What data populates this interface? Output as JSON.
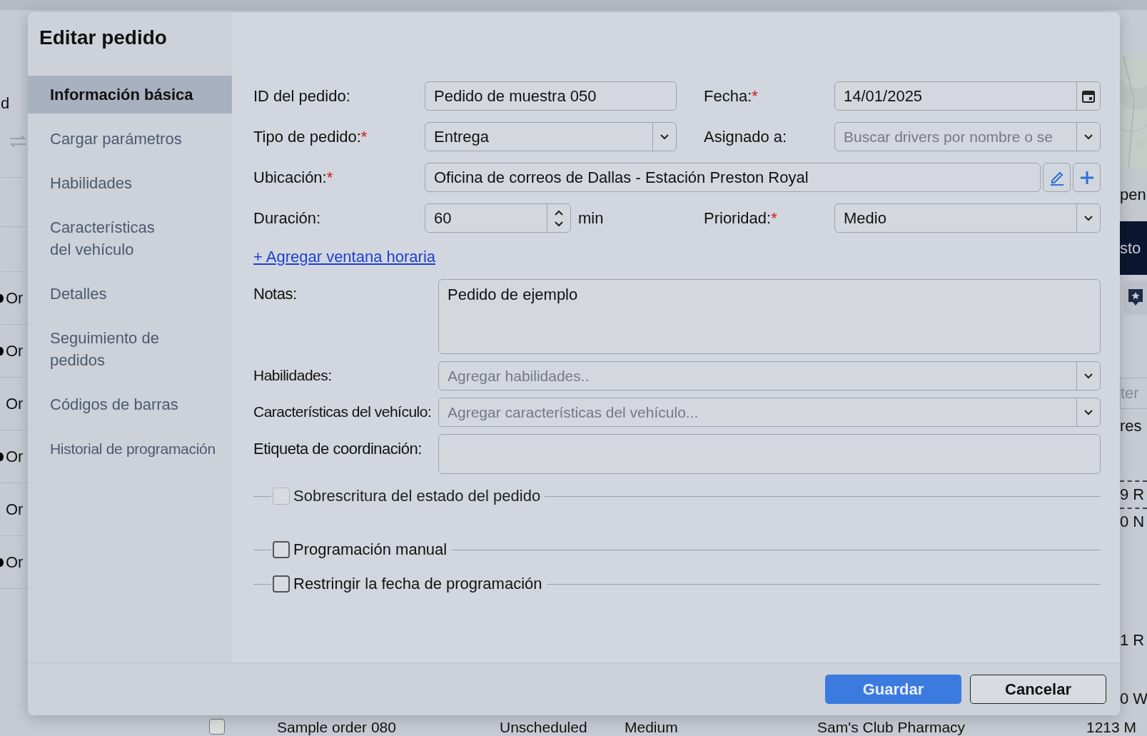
{
  "background": {
    "left_column": {
      "header_fragment": "d",
      "rows": [
        {
          "text": "Or",
          "dot": true
        },
        {
          "text": "Or",
          "dot": true
        },
        {
          "text": "Or",
          "dot": false
        },
        {
          "text": "Or",
          "dot": true
        },
        {
          "text": "Or",
          "dot": false
        },
        {
          "text": "Or",
          "dot": true
        }
      ]
    },
    "right_column": {
      "map_button": "pen",
      "banner": "sto",
      "filter_fragment": "ter",
      "rows": [
        {
          "text": "res",
          "dashed": false
        },
        {
          "text": "9 R",
          "dashed": true
        },
        {
          "text": "0 N",
          "dashed": true
        },
        {
          "text": "1 R",
          "dashed": false
        },
        {
          "text": "0 W",
          "dashed": false
        }
      ]
    },
    "bottom_row": {
      "checked": false,
      "cells": [
        "Sample order 080",
        "Unscheduled",
        "Medium",
        "Sam's Club Pharmacy",
        "1213 M"
      ]
    }
  },
  "dialog": {
    "title": "Editar pedido",
    "nav": [
      {
        "label": "Información básica",
        "selected": true
      },
      {
        "label": "Cargar parámetros",
        "selected": false
      },
      {
        "label": "Habilidades",
        "selected": false
      },
      {
        "label": "Características del vehículo",
        "selected": false
      },
      {
        "label": "Detalles",
        "selected": false
      },
      {
        "label": "Seguimiento de pedidos",
        "selected": false
      },
      {
        "label": "Códigos de barras",
        "selected": false
      },
      {
        "label": "Historial de programación",
        "selected": false
      }
    ],
    "form_rows": [
      [
        {
          "label": "ID del pedido:",
          "kind": "text",
          "value": "Pedido de muestra 050"
        },
        {
          "label": "Fecha:",
          "required_mark": "*",
          "kind": "date",
          "value": "14/01/2025"
        }
      ],
      [
        {
          "label": "Tipo de pedido:",
          "required_mark": "*",
          "kind": "select",
          "value": "Entrega"
        },
        {
          "label": "Asignado a:",
          "kind": "select",
          "placeholder": "Buscar drivers por nombre o se"
        }
      ],
      [
        {
          "label": "Ubicación:",
          "required_mark": "*",
          "kind": "location",
          "value": "Oficina de correos de Dallas - Estación Preston Royal"
        }
      ],
      [
        {
          "label": "Duración:",
          "kind": "number",
          "value": "60",
          "unit": "min"
        },
        {
          "label": "Prioridad:",
          "required_mark": "*",
          "kind": "select",
          "value": "Medio"
        }
      ]
    ],
    "time_window_link": "+ Agregar ventana horaria",
    "lower_fields": [
      {
        "label": "Notas:",
        "kind": "textarea",
        "value": "Pedido de ejemplo"
      },
      {
        "label": "Habilidades:",
        "kind": "select",
        "placeholder": "Agregar habilidades.."
      },
      {
        "label": "Características del vehículo:",
        "kind": "select",
        "placeholder": "Agregar características del vehículo..."
      },
      {
        "label": "Etiqueta de coordinación:",
        "kind": "text"
      }
    ],
    "options": [
      {
        "label": "Sobrescritura del estado del pedido",
        "checked": false,
        "disabled": true
      },
      {
        "label": "Programación manual",
        "checked": false,
        "disabled": false
      },
      {
        "label": "Restringir la fecha de programación",
        "checked": false,
        "disabled": false
      }
    ],
    "buttons": [
      {
        "label": "Guardar",
        "kind": "primary"
      },
      {
        "label": "Cancelar",
        "kind": "secondary"
      }
    ]
  }
}
